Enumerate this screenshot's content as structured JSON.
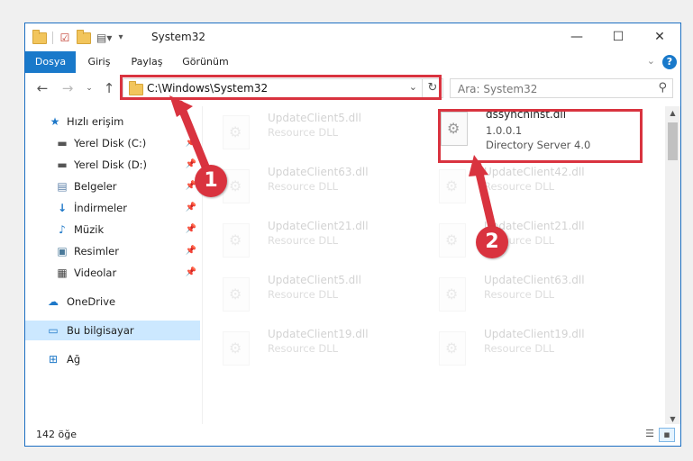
{
  "window": {
    "title": "System32",
    "minimize": "—",
    "maximize": "☐",
    "close": "✕"
  },
  "ribbon": {
    "tabs": [
      "Dosya",
      "Giriş",
      "Paylaş",
      "Görünüm"
    ],
    "help": "?"
  },
  "nav": {
    "address": "C:\\Windows\\System32",
    "search_placeholder": "Ara: System32"
  },
  "sidebar": {
    "items": [
      {
        "label": "Hızlı erişim",
        "icon": "star-icon",
        "pinned": false
      },
      {
        "label": "Yerel Disk (C:)",
        "icon": "drive-icon",
        "pinned": true
      },
      {
        "label": "Yerel Disk (D:)",
        "icon": "drive-icon",
        "pinned": true
      },
      {
        "label": "Belgeler",
        "icon": "documents-icon",
        "pinned": true
      },
      {
        "label": "İndirmeler",
        "icon": "download-icon",
        "pinned": true
      },
      {
        "label": "Müzik",
        "icon": "music-icon",
        "pinned": true
      },
      {
        "label": "Resimler",
        "icon": "pictures-icon",
        "pinned": true
      },
      {
        "label": "Videolar",
        "icon": "video-icon",
        "pinned": true
      },
      {
        "label": "OneDrive",
        "icon": "cloud-icon",
        "pinned": false
      },
      {
        "label": "Bu bilgisayar",
        "icon": "computer-icon",
        "pinned": false,
        "selected": true
      },
      {
        "label": "Ağ",
        "icon": "network-icon",
        "pinned": false
      }
    ]
  },
  "files": {
    "left": [
      {
        "name": "UpdateClient5.dll",
        "type": "Resource DLL"
      },
      {
        "name": "UpdateClient63.dll",
        "type": "Resource DLL"
      },
      {
        "name": "UpdateClient21.dll",
        "type": "Resource DLL"
      },
      {
        "name": "UpdateClient5.dll",
        "type": "Resource DLL"
      },
      {
        "name": "UpdateClient19.dll",
        "type": "Resource DLL"
      }
    ],
    "right": [
      {
        "name": "UpdateClient42.dll",
        "type": "Resource DLL"
      },
      {
        "name": "UpdateClient21.dll",
        "type": "Resource DLL"
      },
      {
        "name": "UpdateClient63.dll",
        "type": "Resource DLL"
      },
      {
        "name": "UpdateClient19.dll",
        "type": "Resource DLL"
      }
    ],
    "highlighted": {
      "name": "dssynchinst.dll",
      "version": "1.0.0.1",
      "description": "Directory Server 4.0"
    }
  },
  "status": {
    "count": "142 öğe"
  },
  "annotations": {
    "step1": "1",
    "step2": "2",
    "color": "#d9333f"
  }
}
